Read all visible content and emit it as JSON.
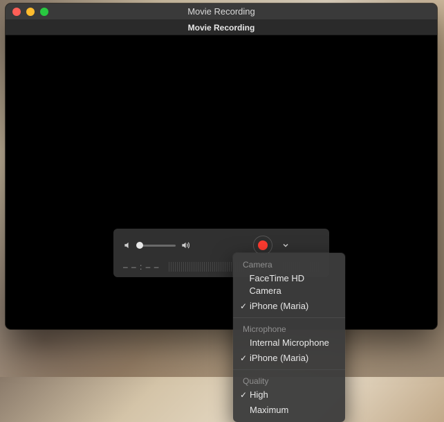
{
  "window": {
    "title": "Movie Recording",
    "doc_title": "Movie Recording"
  },
  "controls": {
    "timecode": "– – : – –",
    "volume": {
      "value_pct": 6
    }
  },
  "menu": {
    "sections": [
      {
        "header": "Camera",
        "items": [
          {
            "label": "FaceTime HD Camera",
            "checked": false
          },
          {
            "label": "iPhone (Maria)",
            "checked": true
          }
        ]
      },
      {
        "header": "Microphone",
        "items": [
          {
            "label": "Internal Microphone",
            "checked": false
          },
          {
            "label": "iPhone (Maria)",
            "checked": true
          }
        ]
      },
      {
        "header": "Quality",
        "items": [
          {
            "label": "High",
            "checked": true
          },
          {
            "label": "Maximum",
            "checked": false
          }
        ]
      }
    ]
  }
}
